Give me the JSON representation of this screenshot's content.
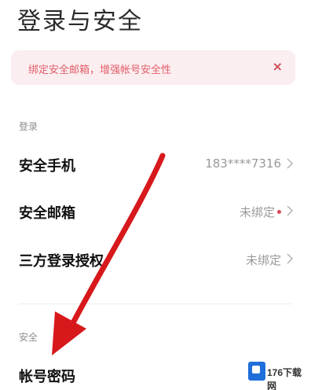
{
  "header": {
    "title": "登录与安全"
  },
  "alert": {
    "text": "绑定安全邮箱，增强帐号安全性",
    "close_glyph": "×"
  },
  "sections": {
    "login": {
      "label": "登录"
    },
    "security": {
      "label": "安全"
    }
  },
  "rows": {
    "phone": {
      "title": "安全手机",
      "value": "183****7316"
    },
    "email": {
      "title": "安全邮箱",
      "value": "未绑定"
    },
    "third_party": {
      "title": "三方登录授权",
      "value": "未绑定"
    },
    "password": {
      "title": "帐号密码"
    }
  },
  "watermark": {
    "text": "176下载网"
  },
  "colors": {
    "alert_bg": "#fbeef0",
    "alert_text": "#e25e6a",
    "status_dot": "#d94555",
    "annotation_arrow": "#d7191c"
  },
  "icons": [
    "close-icon",
    "chevron-right-icon",
    "status-dot-icon",
    "annotation-arrow"
  ]
}
